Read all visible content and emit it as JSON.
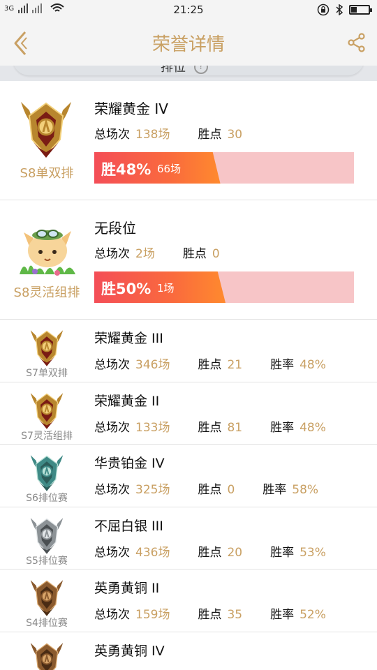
{
  "status_bar": {
    "network": "3G",
    "time": "21:25"
  },
  "header": {
    "title": "荣誉详情"
  },
  "tab": {
    "label": "排位",
    "info": "?"
  },
  "entries": [
    {
      "size": "big",
      "season": "S8单双排",
      "rank": "荣耀黄金 IV",
      "badge": "gold-badge",
      "stats": [
        {
          "label": "总场次",
          "value": "138场"
        },
        {
          "label": "胜点",
          "value": "30"
        }
      ],
      "win_label": "胜48%",
      "win_fraction": 0.48,
      "wins": "66场"
    },
    {
      "size": "big",
      "season": "S8灵活组排",
      "rank": "无段位",
      "badge": "teemo-mascot",
      "stats": [
        {
          "label": "总场次",
          "value": "2场"
        },
        {
          "label": "胜点",
          "value": "0"
        }
      ],
      "win_label": "胜50%",
      "win_fraction": 0.5,
      "wins": "1场"
    },
    {
      "size": "small",
      "season": "S7单双排",
      "rank": "荣耀黄金 III",
      "badge": "gold-badge",
      "stats": [
        {
          "label": "总场次",
          "value": "346场"
        },
        {
          "label": "胜点",
          "value": "21"
        },
        {
          "label": "胜率",
          "value": "48%"
        }
      ]
    },
    {
      "size": "small",
      "season": "S7灵活组排",
      "rank": "荣耀黄金 II",
      "badge": "gold-badge",
      "stats": [
        {
          "label": "总场次",
          "value": "133场"
        },
        {
          "label": "胜点",
          "value": "81"
        },
        {
          "label": "胜率",
          "value": "48%"
        }
      ]
    },
    {
      "size": "small",
      "season": "S6排位赛",
      "rank": "华贵铂金 IV",
      "badge": "platinum-badge",
      "stats": [
        {
          "label": "总场次",
          "value": "325场"
        },
        {
          "label": "胜点",
          "value": "0"
        },
        {
          "label": "胜率",
          "value": "58%"
        }
      ]
    },
    {
      "size": "small",
      "season": "S5排位赛",
      "rank": "不屈白银 III",
      "badge": "silver-badge",
      "stats": [
        {
          "label": "总场次",
          "value": "436场"
        },
        {
          "label": "胜点",
          "value": "20"
        },
        {
          "label": "胜率",
          "value": "53%"
        }
      ]
    },
    {
      "size": "small",
      "season": "S4排位赛",
      "rank": "英勇黄铜 II",
      "badge": "bronze-badge",
      "stats": [
        {
          "label": "总场次",
          "value": "159场"
        },
        {
          "label": "胜点",
          "value": "35"
        },
        {
          "label": "胜率",
          "value": "52%"
        }
      ]
    },
    {
      "size": "small",
      "season": "",
      "rank": "英勇黄铜 IV",
      "badge": "bronze-badge",
      "stats": []
    }
  ],
  "colors": {
    "accent": "#c9a063",
    "gold": "#b8862e",
    "platinum": "#3f8a86",
    "silver": "#8c9296",
    "bronze": "#8a5a2e",
    "bar_fill": "#f44e57",
    "bar_track": "#f7c5c7"
  }
}
